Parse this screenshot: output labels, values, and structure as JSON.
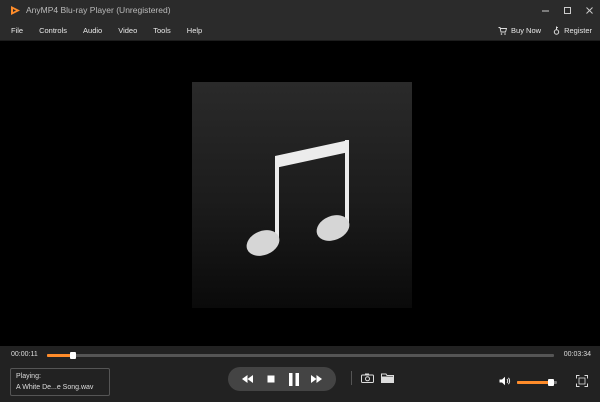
{
  "window": {
    "title": "AnyMP4 Blu-ray Player (Unregistered)",
    "controls": [
      "minimize",
      "restore",
      "close"
    ]
  },
  "menu": {
    "items": [
      {
        "label": "File"
      },
      {
        "label": "Controls"
      },
      {
        "label": "Audio"
      },
      {
        "label": "Video"
      },
      {
        "label": "Tools"
      },
      {
        "label": "Help"
      }
    ],
    "buy_now": "Buy Now",
    "register": "Register"
  },
  "player": {
    "artwork_icon": "music-note-icon",
    "time_current": "00:00:11",
    "time_total": "00:03:34",
    "progress_fraction": 0.052,
    "playing_label": "Playing:",
    "playing_file": "A White De...e Song.wav",
    "volume_fraction": 0.85,
    "accent_color": "#ff8c2a"
  },
  "icons": {
    "transport": [
      "rewind-icon",
      "stop-icon",
      "pause-icon",
      "fast-forward-icon"
    ],
    "extra": [
      "snapshot-icon",
      "open-folder-icon"
    ],
    "volume": "speaker-icon",
    "fullscreen": "fullscreen-icon"
  }
}
